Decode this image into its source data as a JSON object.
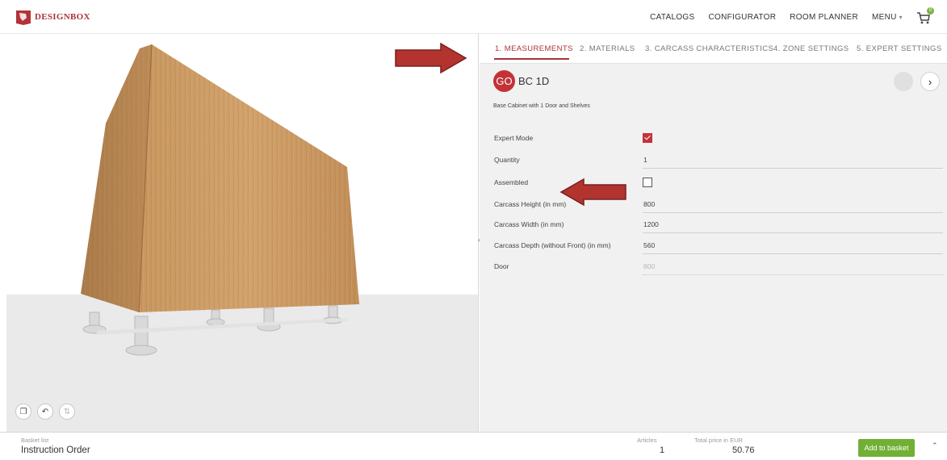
{
  "brand": {
    "name": "DESIGNBOX",
    "color": "#a8343a"
  },
  "nav": {
    "items": [
      "CATALOGS",
      "CONFIGURATOR",
      "ROOM PLANNER",
      "MENU"
    ],
    "cart_icon": "cart-icon",
    "cart_badge": "0"
  },
  "tabs": [
    "1. MEASUREMENTS",
    "2. MATERIALS",
    "3. CARCASS CHARACTERISTICS",
    "4. ZONE SETTINGS",
    "5. EXPERT SETTINGS"
  ],
  "active_tab": "1. MEASUREMENTS",
  "product": {
    "badge": "GO",
    "code": "BC 1D",
    "description": "Base Cabinet with 1 Door and Shelves"
  },
  "form": {
    "expert_mode": {
      "label": "Expert Mode",
      "checked": true
    },
    "quantity": {
      "label": "Quantity",
      "value": "1"
    },
    "assembled": {
      "label": "Assembled",
      "checked": false
    },
    "carcass_height": {
      "label": "Carcass Height (in mm)",
      "value": "800"
    },
    "carcass_width": {
      "label": "Carcass Width (in mm)",
      "value": "1200"
    },
    "carcass_depth": {
      "label": "Carcass Depth (without Front) (in mm)",
      "value": "560"
    },
    "door": {
      "label": "Door",
      "value": "800"
    }
  },
  "viewer_tools": [
    "box-view-icon",
    "undo-icon",
    "reset-icon"
  ],
  "footer": {
    "basket_label": "Basket list",
    "basket_name": "Instruction Order",
    "articles_label": "Articles",
    "articles_value": "1",
    "total_label": "Total price in EUR",
    "total_value": "50.76",
    "add_button": "Add to basket"
  },
  "colors": {
    "accent": "#c33237",
    "add_button": "#70b035",
    "annotation_arrow": "#b3332f",
    "wood": "#c49562"
  }
}
